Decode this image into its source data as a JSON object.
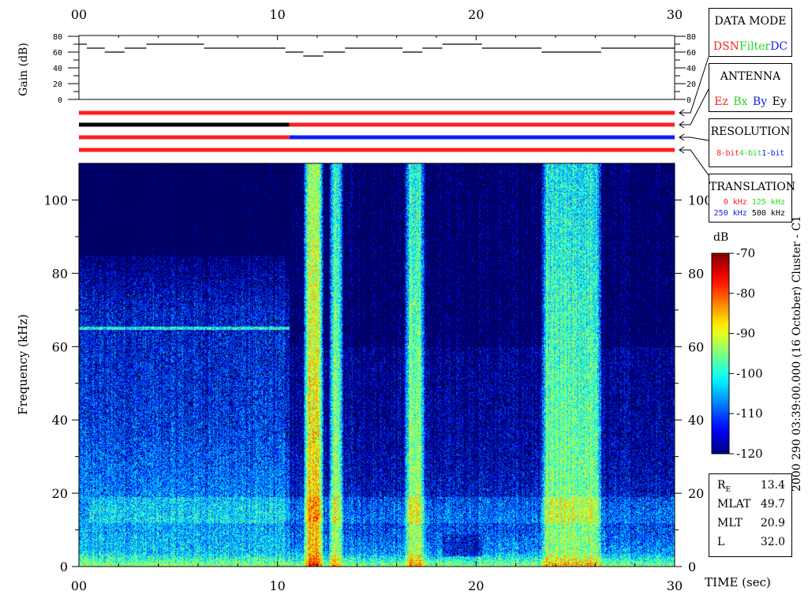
{
  "colors": {
    "red": "#ff2020",
    "green": "#22dd22",
    "blue": "#1020ee",
    "black": "#000000"
  },
  "data_mode": {
    "title": "DATA MODE",
    "items": [
      {
        "label": "DSN",
        "color": "#ff2020"
      },
      {
        "label": "Filter",
        "color": "#22dd22"
      },
      {
        "label": "DC",
        "color": "#1020ee"
      }
    ]
  },
  "antenna": {
    "title": "ANTENNA",
    "items": [
      {
        "label": "Ez",
        "color": "#ff2020"
      },
      {
        "label": "Bx",
        "color": "#22dd22"
      },
      {
        "label": "By",
        "color": "#1020ee"
      },
      {
        "label": "Ey",
        "color": "#000000"
      }
    ]
  },
  "resolution": {
    "title": "RESOLUTION",
    "items": [
      {
        "label": "8-bit",
        "color": "#ff2020"
      },
      {
        "label": "4-bit",
        "color": "#22dd22"
      },
      {
        "label": "1-bit",
        "color": "#1020ee"
      }
    ]
  },
  "translation": {
    "title": "TRANSLATION",
    "row1": [
      {
        "label": "0 kHz",
        "color": "#ff2020"
      },
      {
        "label": "125 kHz",
        "color": "#22dd22"
      }
    ],
    "row2": [
      {
        "label": "250 kHz",
        "color": "#1020ee"
      },
      {
        "label": "500 kHz",
        "color": "#000000"
      }
    ]
  },
  "info": {
    "re_label": "R",
    "re_sub": "E",
    "re_value": "13.4",
    "mlat_label": "MLAT",
    "mlat_value": "49.7",
    "mlt_label": "MLT",
    "mlt_value": "20.9",
    "l_label": "L",
    "l_value": "32.0"
  },
  "side_title": "2000 290 03:39:00.000 (16 October)  Cluster - C1",
  "colorbar": {
    "unit": "dB",
    "ticks": [
      "-70",
      "-80",
      "-90",
      "-100",
      "-110",
      "-120"
    ]
  },
  "chart_data": [
    {
      "type": "line",
      "name": "gain",
      "ylabel": "Gain (dB)",
      "xlim": [
        0,
        30
      ],
      "ylim": [
        0,
        80
      ],
      "x_ticks": [
        "00",
        "10",
        "20",
        "30"
      ],
      "y_ticks": [
        "80",
        "60",
        "40",
        "20",
        "0"
      ],
      "segments": [
        {
          "x": [
            0.0,
            0.4
          ],
          "y": 70
        },
        {
          "x": [
            0.4,
            1.3
          ],
          "y": 65
        },
        {
          "x": [
            1.3,
            2.3
          ],
          "y": 60
        },
        {
          "x": [
            2.3,
            3.4
          ],
          "y": 65
        },
        {
          "x": [
            3.4,
            6.3
          ],
          "y": 70
        },
        {
          "x": [
            6.3,
            10.4
          ],
          "y": 65
        },
        {
          "x": [
            10.4,
            11.3
          ],
          "y": 60
        },
        {
          "x": [
            11.3,
            12.3
          ],
          "y": 55
        },
        {
          "x": [
            12.3,
            13.4
          ],
          "y": 60
        },
        {
          "x": [
            13.4,
            16.3
          ],
          "y": 65
        },
        {
          "x": [
            16.3,
            17.3
          ],
          "y": 60
        },
        {
          "x": [
            17.3,
            18.3
          ],
          "y": 65
        },
        {
          "x": [
            18.3,
            20.3
          ],
          "y": 70
        },
        {
          "x": [
            20.3,
            23.3
          ],
          "y": 65
        },
        {
          "x": [
            23.3,
            26.3
          ],
          "y": 60
        },
        {
          "x": [
            26.3,
            30.0
          ],
          "y": 65
        }
      ]
    },
    {
      "type": "table",
      "name": "mode-bars",
      "bars": [
        {
          "segments": [
            {
              "from": 0,
              "to": 30,
              "color": "#ff2020"
            }
          ]
        },
        {
          "segments": [
            {
              "from": 0,
              "to": 10.6,
              "color": "#000000"
            },
            {
              "from": 10.6,
              "to": 30,
              "color": "#ff2020"
            }
          ]
        },
        {
          "segments": [
            {
              "from": 0,
              "to": 10.6,
              "color": "#ff2020"
            },
            {
              "from": 10.6,
              "to": 30,
              "color": "#1020ee"
            }
          ]
        },
        {
          "segments": [
            {
              "from": 0,
              "to": 30,
              "color": "#ff2020"
            }
          ]
        }
      ]
    },
    {
      "type": "heatmap",
      "name": "spectrogram",
      "xlabel": "TIME (sec)",
      "ylabel": "Frequency (kHz)",
      "xlim": [
        0,
        30
      ],
      "ylim": [
        0,
        110
      ],
      "x_ticks": [
        "00",
        "10",
        "20",
        "30"
      ],
      "y_ticks": [
        "100",
        "80",
        "60",
        "40",
        "20",
        "0"
      ],
      "zlim": [
        -120,
        -70
      ],
      "zunit": "dB",
      "bursts": [
        {
          "t_start": 11.3,
          "t_end": 12.3,
          "level_db": -88
        },
        {
          "t_start": 12.6,
          "t_end": 13.3,
          "level_db": -95
        },
        {
          "t_start": 16.4,
          "t_end": 17.4,
          "level_db": -95
        },
        {
          "t_start": 23.3,
          "t_end": 26.3,
          "level_db": -97
        }
      ],
      "line_frequency_khz": 65.2
    }
  ]
}
